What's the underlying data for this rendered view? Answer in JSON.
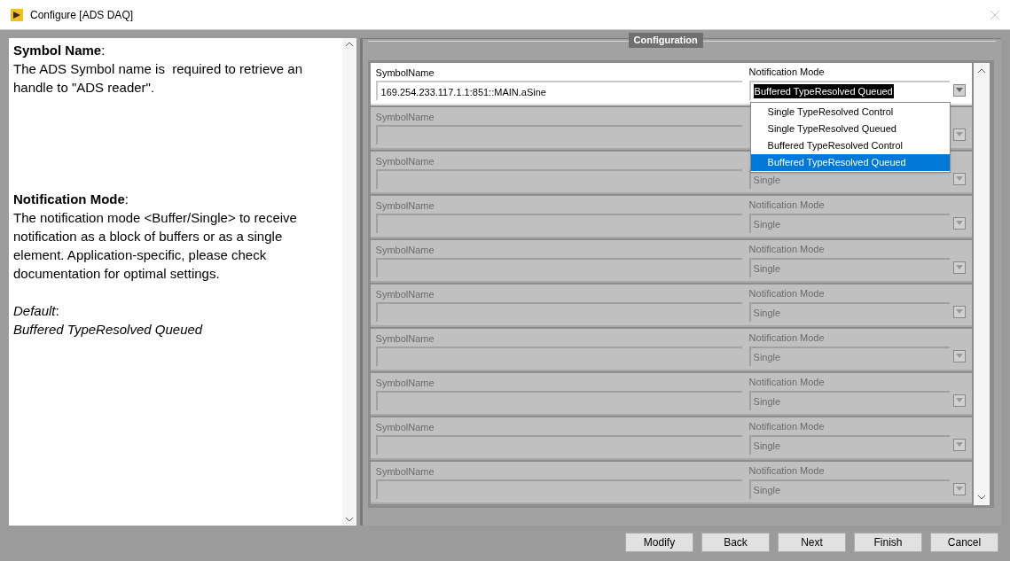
{
  "window": {
    "title": "Configure [ADS DAQ]"
  },
  "help": [
    {
      "kind": "text",
      "text": "**Symbol Name**:"
    },
    {
      "kind": "text",
      "text": "The ADS Symbol name is  required to retrieve an handle to \"ADS reader\"."
    },
    {
      "kind": "gap"
    },
    {
      "kind": "text",
      "text": "**Notification Mode**:"
    },
    {
      "kind": "text",
      "text": "The notification mode <Buffer/Single> to receive notification as a block of buffers or as a single element. Application-specific, please check documentation for optimal settings."
    },
    {
      "kind": "smallgap"
    },
    {
      "kind": "text",
      "text": "*Default*:"
    },
    {
      "kind": "italic",
      "text": "Buffered TypeResolved Queued"
    }
  ],
  "config": {
    "title": "Configuration",
    "rows": [
      {
        "disabled": false,
        "symbol_label": "SymbolName",
        "symbol_value": "169.254.233.117.1.1:851::MAIN.aSine",
        "mode_label": "Notification Mode",
        "mode_value": "Buffered TypeResolved Queued",
        "mode_highlighted": true
      },
      {
        "disabled": true,
        "symbol_label": "SymbolName"
      },
      {
        "disabled": true,
        "symbol_label": "SymbolName",
        "mode_value": "Single"
      },
      {
        "disabled": true,
        "symbol_label": "SymbolName",
        "mode_label": "Notification Mode",
        "mode_value": "Single"
      },
      {
        "disabled": true,
        "symbol_label": "SymbolName",
        "mode_label": "Notification Mode",
        "mode_value": "Single"
      },
      {
        "disabled": true,
        "symbol_label": "SymbolName",
        "mode_label": "Notification Mode",
        "mode_value": "Single"
      },
      {
        "disabled": true,
        "symbol_label": "SymbolName",
        "mode_label": "Notification Mode",
        "mode_value": "Single"
      },
      {
        "disabled": true,
        "symbol_label": "SymbolName",
        "mode_label": "Notification Mode",
        "mode_value": "Single"
      },
      {
        "disabled": true,
        "symbol_label": "SymbolName",
        "mode_label": "Notification Mode",
        "mode_value": "Single"
      },
      {
        "disabled": true,
        "symbol_label": "SymbolName",
        "mode_label": "Notification Mode",
        "mode_value": "Single"
      }
    ],
    "dropdown": {
      "options": [
        {
          "label": "Single TypeResolved Control",
          "selected": false
        },
        {
          "label": "Single TypeResolved Queued",
          "selected": false
        },
        {
          "label": "Buffered TypeResolved Control",
          "selected": false
        },
        {
          "label": "Buffered TypeResolved Queued",
          "selected": true
        }
      ]
    }
  },
  "buttons": [
    "Modify",
    "Back",
    "Next",
    "Finish",
    "Cancel"
  ]
}
